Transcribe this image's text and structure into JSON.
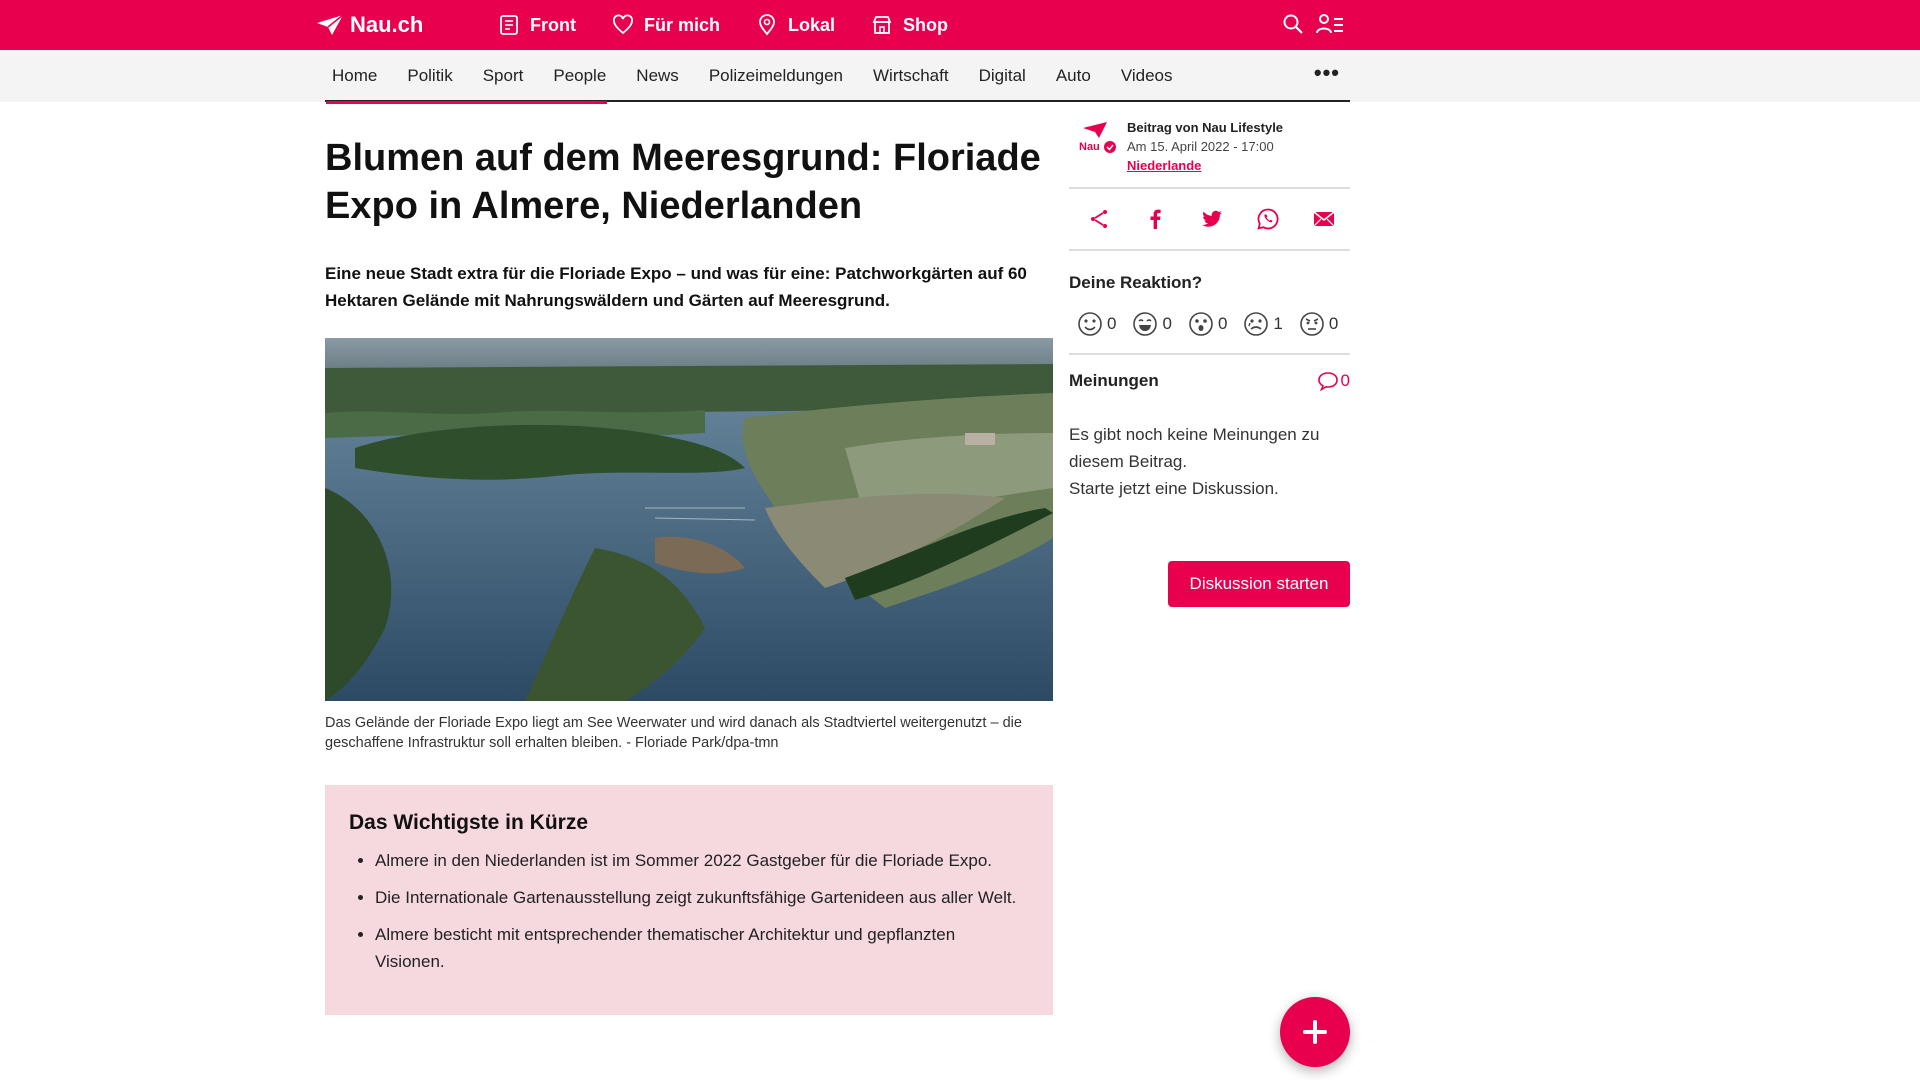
{
  "brand": {
    "name": "Nau.ch",
    "accent": "#e8004f"
  },
  "topnav": [
    {
      "label": "Front",
      "icon": "newspaper-icon"
    },
    {
      "label": "Für mich",
      "icon": "heart-icon"
    },
    {
      "label": "Lokal",
      "icon": "location-pin-icon"
    },
    {
      "label": "Shop",
      "icon": "shop-icon"
    }
  ],
  "subnav": {
    "items": [
      "Home",
      "Politik",
      "Sport",
      "People",
      "News",
      "Polizeimeldungen",
      "Wirtschaft",
      "Digital",
      "Auto",
      "Videos"
    ],
    "active": "Home",
    "more": "•••"
  },
  "article": {
    "headline": "Blumen auf dem Meeresgrund: Floriade Expo in Almere, Niederlanden",
    "lead": "Eine neue Stadt extra für die Floriade Expo – und was für eine: Patchworkgärten auf 60 Hektaren Gelände mit Nahrungswäldern und Gärten auf Meeresgrund.",
    "caption": "Das Gelände der Floriade Expo liegt am See Weerwater und wird danach als Stadtviertel weitergenutzt – die geschaffene Infrastruktur soll erhalten bleiben. - Floriade Park/dpa-tmn",
    "summary": {
      "title": "Das Wichtigste in Kürze",
      "points": [
        "Almere in den Niederlanden ist im Sommer 2022 Gastgeber für die Floriade Expo.",
        "Die Internationale Gartenausstellung zeigt zukunftsfähige Gartenideen aus aller Welt.",
        "Almere besticht mit entsprechender thematischer Architektur und gepflanzten Visionen."
      ]
    }
  },
  "sidebar": {
    "author": "Beitrag von Nau Lifestyle",
    "date": "Am 15. April 2022 - 17:00",
    "tag": "Niederlande",
    "share": [
      "share-icon",
      "facebook-icon",
      "twitter-icon",
      "whatsapp-icon",
      "mail-icon"
    ],
    "reaction_title": "Deine Reaktion?",
    "reactions": [
      {
        "icon": "love-face-icon",
        "count": "0"
      },
      {
        "icon": "laugh-face-icon",
        "count": "0"
      },
      {
        "icon": "surprised-face-icon",
        "count": "0"
      },
      {
        "icon": "sad-face-icon",
        "count": "1"
      },
      {
        "icon": "angry-face-icon",
        "count": "0"
      }
    ],
    "opinions_title": "Meinungen",
    "opinions_count": "0",
    "opinions_empty_1": "Es gibt noch keine Meinungen zu diesem Beitrag.",
    "opinions_empty_2": "Starte jetzt eine Diskussion.",
    "discuss_button": "Diskussion starten"
  }
}
